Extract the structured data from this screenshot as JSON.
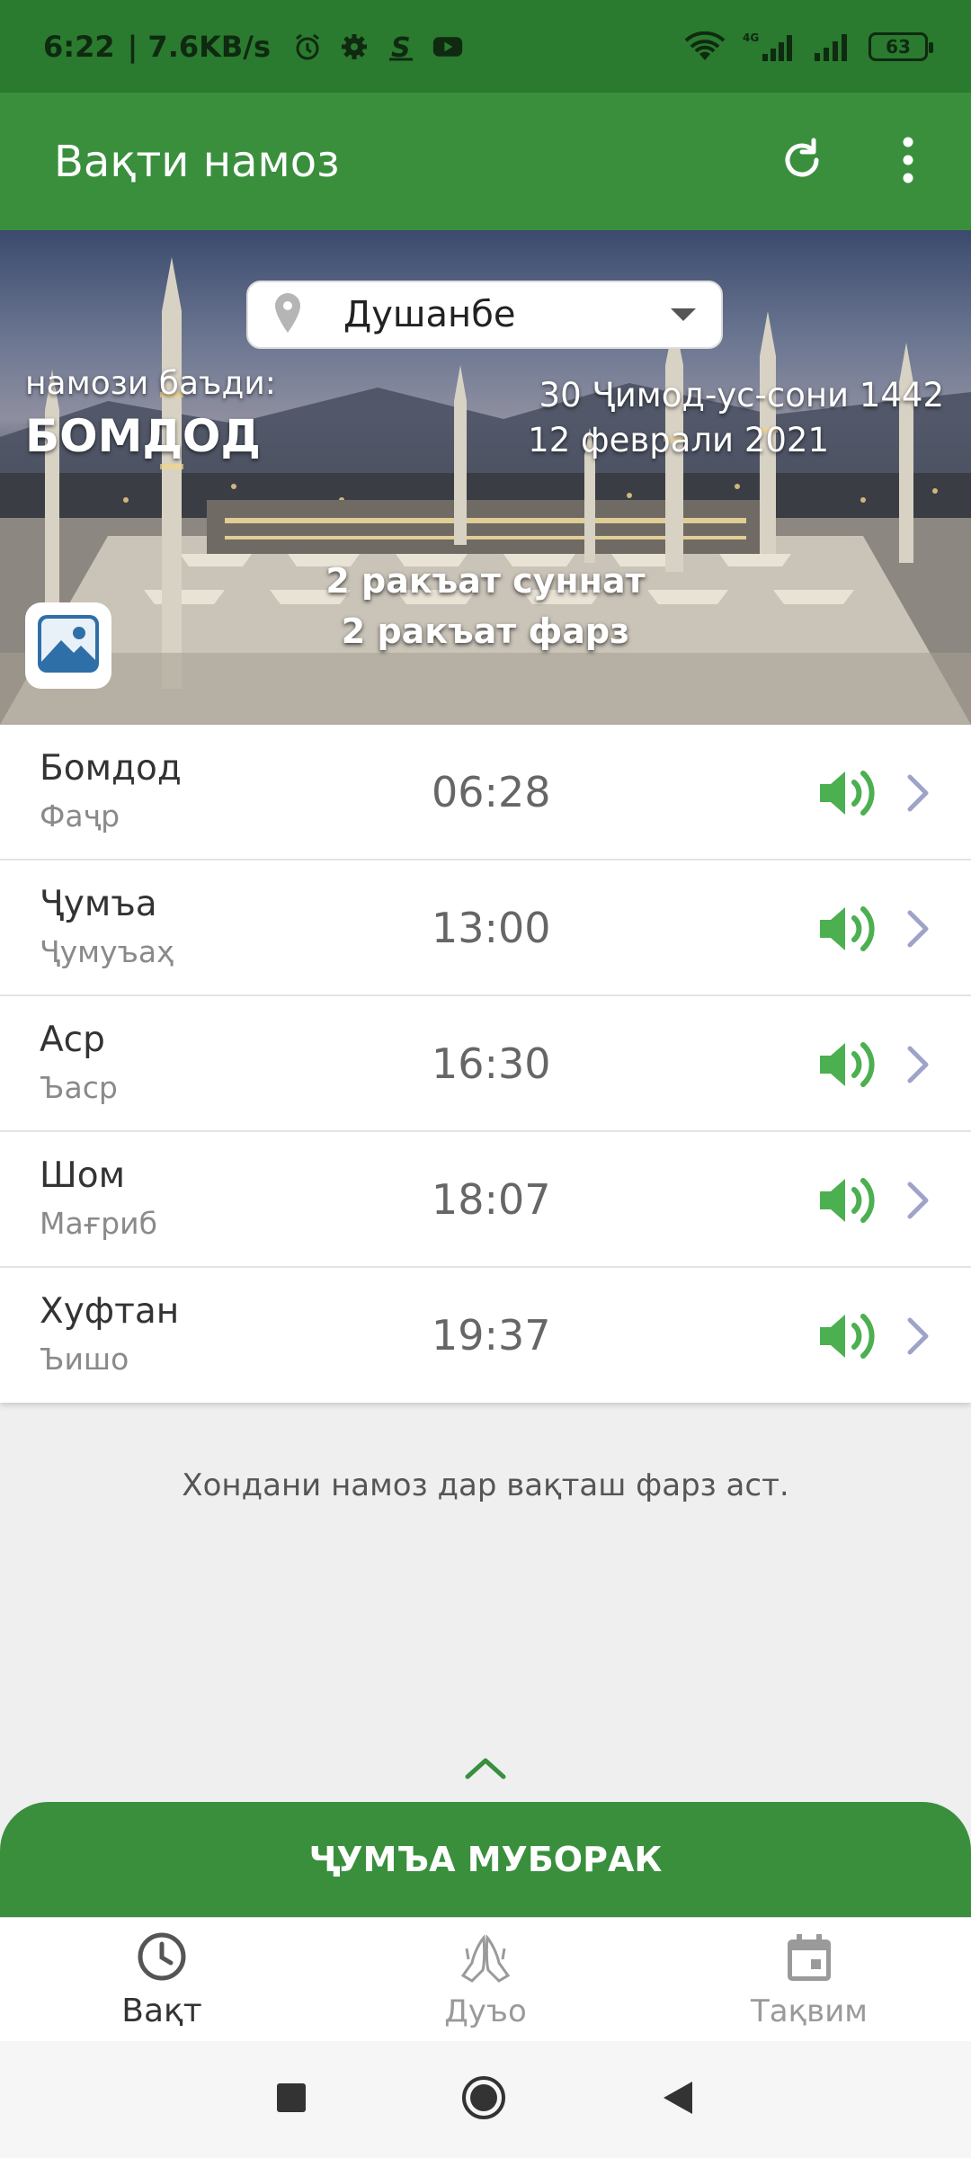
{
  "status_bar": {
    "time": "6:22",
    "net_speed": "| 7.6KB/s",
    "network_type": "4G",
    "battery": "63",
    "icons": [
      "alarm-icon",
      "gear-icon",
      "s-app-icon",
      "youtube-icon",
      "wifi-icon",
      "signal-icon",
      "signal-icon-2",
      "battery-icon"
    ]
  },
  "app_bar": {
    "title": "Вақти намоз",
    "refresh_icon": "refresh-icon",
    "menu_icon": "more-vert-icon"
  },
  "hero": {
    "city": "Душанбе",
    "next_label": "намози баъди:",
    "next_prayer": "БОМДОД",
    "date_hijri": "30 Ҷимод-ус-сони 1442",
    "date_gregorian": "12 феврали 2021",
    "rakat_line1": "2 ракъат суннат",
    "rakat_line2": "2 ракъат фарз"
  },
  "prayers": [
    {
      "name": "Бомдод",
      "sub": "Фаҷр",
      "time": "06:28"
    },
    {
      "name": "Ҷумъа",
      "sub": "Ҷумуъаҳ",
      "time": "13:00"
    },
    {
      "name": "Аср",
      "sub": "Ъаср",
      "time": "16:30"
    },
    {
      "name": "Шом",
      "sub": "Мағриб",
      "time": "18:07"
    },
    {
      "name": "Хуфтан",
      "sub": "Ъишо",
      "time": "19:37"
    }
  ],
  "quote": "Хондани намоз дар вақташ фарз аст.",
  "banner": "ҶУМЪА МУБОРАК",
  "bottom_nav": [
    {
      "label": "Вақт",
      "icon": "clock-icon",
      "active": true
    },
    {
      "label": "Дуъо",
      "icon": "praying-hands-icon",
      "active": false
    },
    {
      "label": "Тақвим",
      "icon": "calendar-icon",
      "active": false
    }
  ],
  "colors": {
    "primary": "#3a8f3d",
    "status_bar": "#2a7a2f",
    "sound_icon": "#4caf50",
    "chevron": "#9fa3c9"
  }
}
